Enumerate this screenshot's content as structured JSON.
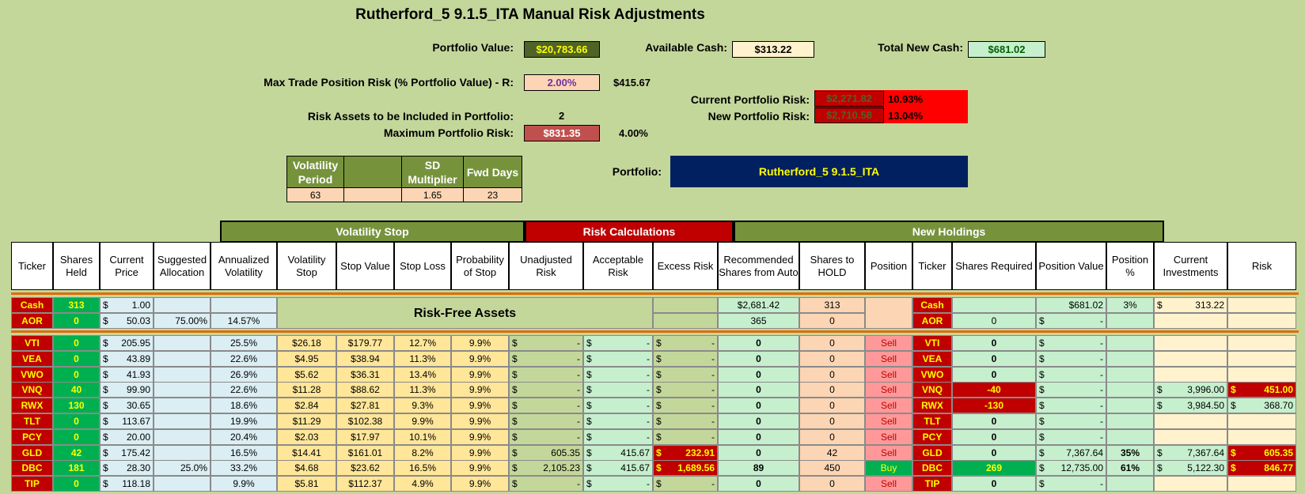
{
  "title": "Rutherford_5 9.1.5_ITA Manual Risk Adjustments",
  "summary": {
    "portfolio_value_label": "Portfolio Value:",
    "portfolio_value": "$20,783.66",
    "available_cash_label": "Available Cash:",
    "available_cash": "$313.22",
    "total_new_cash_label": "Total New Cash:",
    "total_new_cash": "$681.02",
    "max_trade_risk_label": "Max Trade Position Risk (% Portfolio Value) - R:",
    "max_trade_risk_pct": "2.00%",
    "max_trade_risk_value": "$415.67",
    "risk_assets_label": "Risk Assets to be Included in Portfolio:",
    "risk_assets_count": "2",
    "max_portfolio_risk_label": "Maximum Portfolio Risk:",
    "max_portfolio_risk_value": "$831.35",
    "max_portfolio_risk_pct": "4.00%",
    "current_portfolio_risk_label": "Current Portfolio Risk:",
    "current_portfolio_risk_value": "$2,271.82",
    "current_portfolio_risk_pct": "10.93%",
    "new_portfolio_risk_label": "New Portfolio Risk:",
    "new_portfolio_risk_value": "$2,710.58",
    "new_portfolio_risk_pct": "13.04%",
    "portfolio_label": "Portfolio:",
    "portfolio_name": "Rutherford_5 9.1.5_ITA"
  },
  "params": {
    "headers": [
      "Volatility Period",
      "",
      "SD Multiplier",
      "Fwd Days"
    ],
    "values": [
      "63",
      "",
      "1.65",
      "23"
    ]
  },
  "groups": {
    "volatility_stop": "Volatility Stop",
    "risk_calculations": "Risk Calculations",
    "new_holdings": "New Holdings"
  },
  "columns": [
    "Ticker",
    "Shares Held",
    "Current Price",
    "Suggested Allocation",
    "Annualized Volatility",
    "Volatility Stop",
    "Stop Value",
    "Stop Loss",
    "Probability of Stop",
    "Unadjusted Risk",
    "Acceptable Risk",
    "Excess Risk",
    "Recommended Shares from Auto",
    "Shares to HOLD",
    "Position",
    "Ticker",
    "Shares Required",
    "Position Value",
    "Position %",
    "Current Investments",
    "Risk"
  ],
  "risk_free_label": "Risk-Free Assets",
  "cash_row": {
    "ticker": "Cash",
    "shares": "313",
    "price": "1.00",
    "rec": "$2,681.42",
    "hold": "313",
    "ticker2": "Cash",
    "pos_value": "$681.02",
    "pos_pct": "3%",
    "cur_inv": "313.22"
  },
  "aor_row": {
    "ticker": "AOR",
    "shares": "0",
    "price": "50.03",
    "alloc": "75.00%",
    "vol": "14.57%",
    "rec": "365",
    "hold": "0",
    "ticker2": "AOR",
    "req": "0",
    "pos_value": "-"
  },
  "rows": [
    {
      "ticker": "VTI",
      "shares": "0",
      "price": "205.95",
      "alloc": "",
      "vol": "25.5%",
      "vstop": "$26.18",
      "sval": "$179.77",
      "sloss": "12.7%",
      "prob": "9.9%",
      "unadj": "-",
      "acc": "-",
      "excess": "-",
      "rec": "0",
      "hold": "0",
      "pos": "Sell",
      "req": "0",
      "pval": "-",
      "ppct": "",
      "cur": "",
      "risk": ""
    },
    {
      "ticker": "VEA",
      "shares": "0",
      "price": "43.89",
      "alloc": "",
      "vol": "22.6%",
      "vstop": "$4.95",
      "sval": "$38.94",
      "sloss": "11.3%",
      "prob": "9.9%",
      "unadj": "-",
      "acc": "-",
      "excess": "-",
      "rec": "0",
      "hold": "0",
      "pos": "Sell",
      "req": "0",
      "pval": "-",
      "ppct": "",
      "cur": "",
      "risk": ""
    },
    {
      "ticker": "VWO",
      "shares": "0",
      "price": "41.93",
      "alloc": "",
      "vol": "26.9%",
      "vstop": "$5.62",
      "sval": "$36.31",
      "sloss": "13.4%",
      "prob": "9.9%",
      "unadj": "-",
      "acc": "-",
      "excess": "-",
      "rec": "0",
      "hold": "0",
      "pos": "Sell",
      "req": "0",
      "pval": "-",
      "ppct": "",
      "cur": "",
      "risk": ""
    },
    {
      "ticker": "VNQ",
      "shares": "40",
      "price": "99.90",
      "alloc": "",
      "vol": "22.6%",
      "vstop": "$11.28",
      "sval": "$88.62",
      "sloss": "11.3%",
      "prob": "9.9%",
      "unadj": "-",
      "acc": "-",
      "excess": "-",
      "rec": "0",
      "hold": "0",
      "pos": "Sell",
      "req": "-40",
      "pval": "-",
      "ppct": "",
      "cur": "3,996.00",
      "risk": "451.00"
    },
    {
      "ticker": "RWX",
      "shares": "130",
      "price": "30.65",
      "alloc": "",
      "vol": "18.6%",
      "vstop": "$2.84",
      "sval": "$27.81",
      "sloss": "9.3%",
      "prob": "9.9%",
      "unadj": "-",
      "acc": "-",
      "excess": "-",
      "rec": "0",
      "hold": "0",
      "pos": "Sell",
      "req": "-130",
      "pval": "-",
      "ppct": "",
      "cur": "3,984.50",
      "risk": "368.70"
    },
    {
      "ticker": "TLT",
      "shares": "0",
      "price": "113.67",
      "alloc": "",
      "vol": "19.9%",
      "vstop": "$11.29",
      "sval": "$102.38",
      "sloss": "9.9%",
      "prob": "9.9%",
      "unadj": "-",
      "acc": "-",
      "excess": "-",
      "rec": "0",
      "hold": "0",
      "pos": "Sell",
      "req": "0",
      "pval": "-",
      "ppct": "",
      "cur": "",
      "risk": ""
    },
    {
      "ticker": "PCY",
      "shares": "0",
      "price": "20.00",
      "alloc": "",
      "vol": "20.4%",
      "vstop": "$2.03",
      "sval": "$17.97",
      "sloss": "10.1%",
      "prob": "9.9%",
      "unadj": "-",
      "acc": "-",
      "excess": "-",
      "rec": "0",
      "hold": "0",
      "pos": "Sell",
      "req": "0",
      "pval": "-",
      "ppct": "",
      "cur": "",
      "risk": ""
    },
    {
      "ticker": "GLD",
      "shares": "42",
      "price": "175.42",
      "alloc": "",
      "vol": "16.5%",
      "vstop": "$14.41",
      "sval": "$161.01",
      "sloss": "8.2%",
      "prob": "9.9%",
      "unadj": "605.35",
      "acc": "415.67",
      "excess": "232.91",
      "rec": "0",
      "hold": "42",
      "pos": "Sell",
      "req": "0",
      "pval": "7,367.64",
      "ppct": "35%",
      "cur": "7,367.64",
      "risk": "605.35"
    },
    {
      "ticker": "DBC",
      "shares": "181",
      "price": "28.30",
      "alloc": "25.0%",
      "vol": "33.2%",
      "vstop": "$4.68",
      "sval": "$23.62",
      "sloss": "16.5%",
      "prob": "9.9%",
      "unadj": "2,105.23",
      "acc": "415.67",
      "excess": "1,689.56",
      "rec": "89",
      "hold": "450",
      "pos": "Buy",
      "req": "269",
      "pval": "12,735.00",
      "ppct": "61%",
      "cur": "5,122.30",
      "risk": "846.77"
    },
    {
      "ticker": "TIP",
      "shares": "0",
      "price": "118.18",
      "alloc": "",
      "vol": "9.9%",
      "vstop": "$5.81",
      "sval": "$112.37",
      "sloss": "4.9%",
      "prob": "9.9%",
      "unadj": "-",
      "acc": "-",
      "excess": "-",
      "rec": "0",
      "hold": "0",
      "pos": "Sell",
      "req": "0",
      "pval": "-",
      "ppct": "",
      "cur": "",
      "risk": ""
    }
  ],
  "colors": {
    "background": "#c4d79b",
    "header_green": "#76933c",
    "risk_red": "#c00000",
    "portfolio_navy": "#002060",
    "portfolio_text": "#ffff00"
  }
}
